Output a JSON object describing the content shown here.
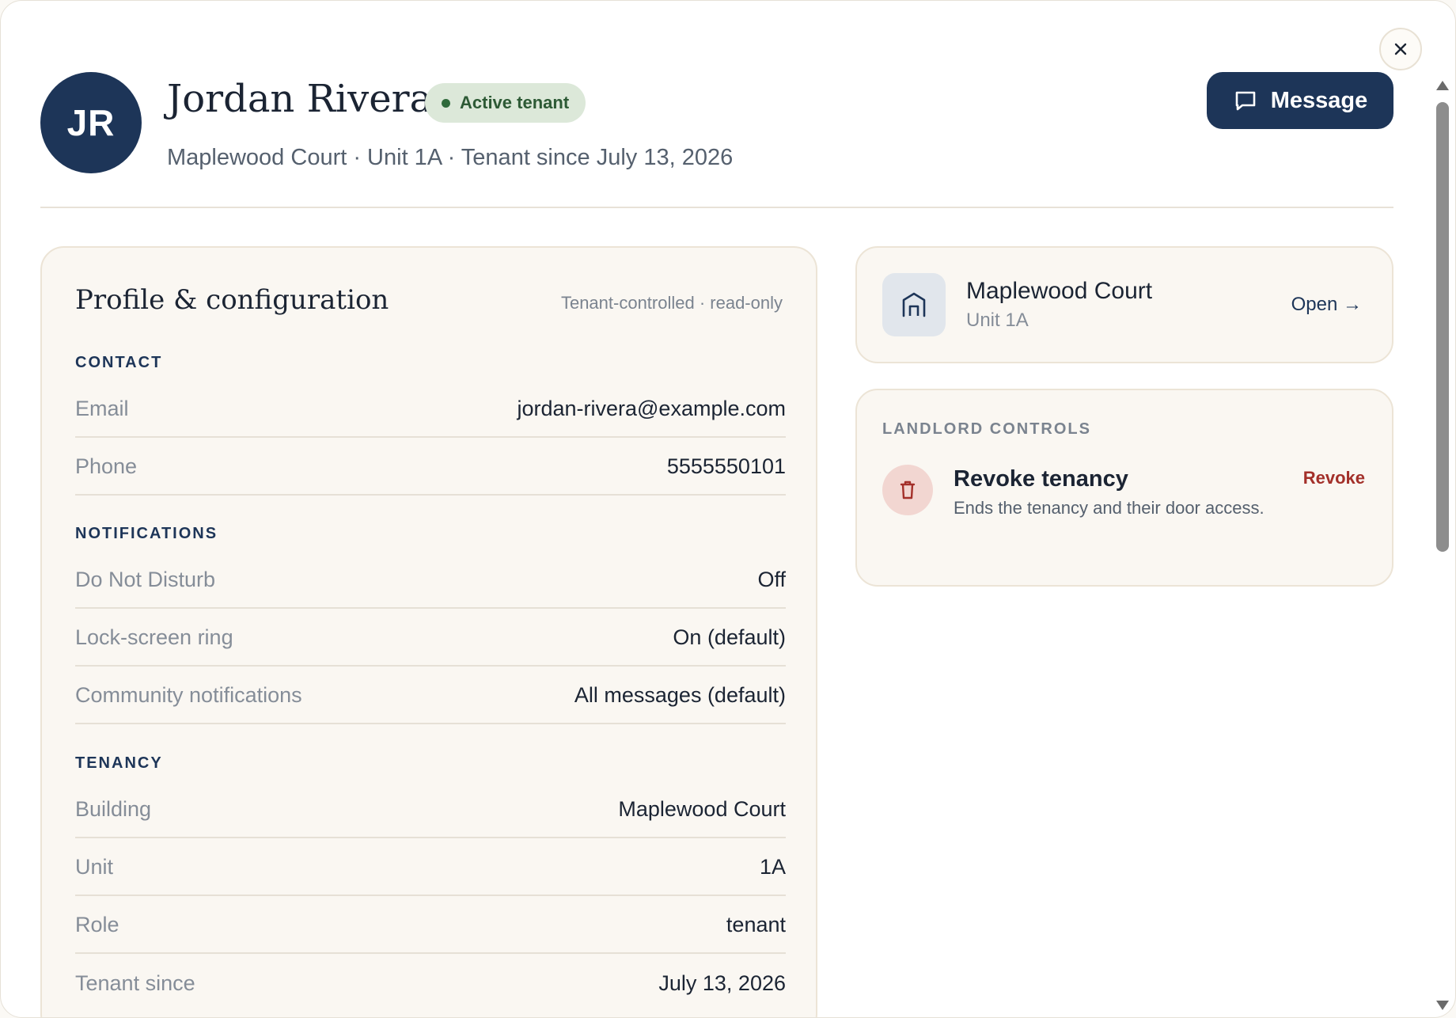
{
  "header": {
    "initials": "JR",
    "name": "Jordan Rivera",
    "status": "Active tenant",
    "subtitle": "Maplewood Court · Unit 1A · Tenant since July 13, 2026",
    "message_label": "Message"
  },
  "profile": {
    "title": "Profile & configuration",
    "note": "Tenant-controlled · read-only",
    "sections": {
      "contact": {
        "heading": "CONTACT",
        "rows": [
          {
            "label": "Email",
            "value": "jordan-rivera@example.com"
          },
          {
            "label": "Phone",
            "value": "5555550101"
          }
        ]
      },
      "notifications": {
        "heading": "NOTIFICATIONS",
        "rows": [
          {
            "label": "Do Not Disturb",
            "value": "Off"
          },
          {
            "label": "Lock-screen ring",
            "value": "On (default)"
          },
          {
            "label": "Community notifications",
            "value": "All messages (default)"
          }
        ]
      },
      "tenancy": {
        "heading": "TENANCY",
        "rows": [
          {
            "label": "Building",
            "value": "Maplewood Court"
          },
          {
            "label": "Unit",
            "value": "1A"
          },
          {
            "label": "Role",
            "value": "tenant"
          },
          {
            "label": "Tenant since",
            "value": "July 13, 2026"
          }
        ]
      }
    }
  },
  "building_card": {
    "name": "Maplewood Court",
    "unit": "Unit 1A",
    "open_label": "Open →"
  },
  "controls": {
    "heading": "LANDLORD CONTROLS",
    "revoke_title": "Revoke tenancy",
    "revoke_desc": "Ends the tenancy and their door access.",
    "revoke_label": "Revoke"
  },
  "colors": {
    "primary": "#1d3558",
    "badge_bg": "#dce8d9",
    "badge_text": "#2d5a35",
    "danger": "#a3302a",
    "danger_bg": "#f2d6d1"
  },
  "icons": {
    "close": "close-icon",
    "message": "chat-bubble-icon",
    "building": "building-icon",
    "trash": "trash-icon"
  }
}
